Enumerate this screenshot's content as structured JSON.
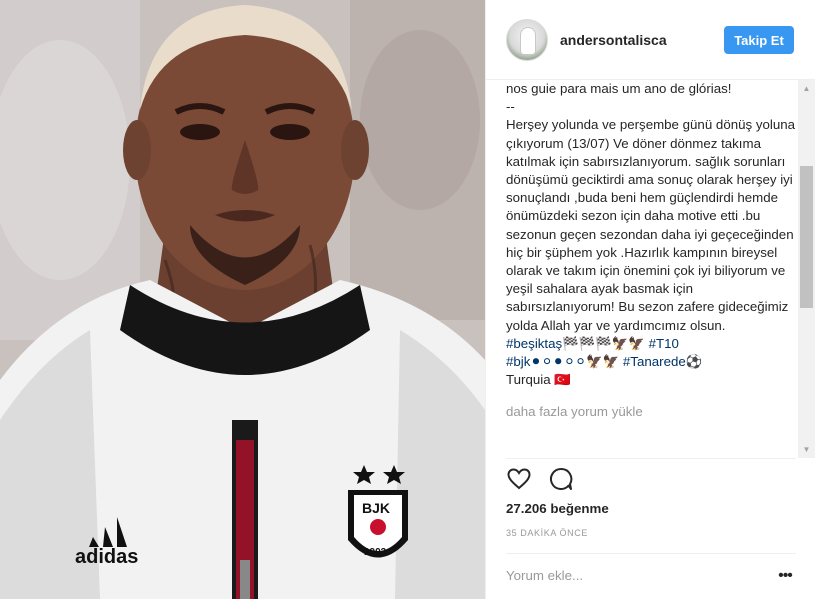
{
  "post": {
    "username": "andersontalisca",
    "follow_label": "Takip Et"
  },
  "caption": {
    "text": "nos guie para mais um ano de glórias!\n--\nHerşey yolunda ve perşembe günü dönüş yoluna çıkıyorum (13/07) Ve döner dönmez takıma katılmak için sabırsızlanıyorum. sağlık sorunları dönüşümü geciktirdi ama sonuç olarak herşey iyi sonuçlandı ,buda beni hem güçlendirdi hemde önümüzdeki sezon için daha motive etti .bu sezonun geçen sezondan daha iyi geçeceğinden hiç bir şüphem yok .Hazırlık kampının bireysel olarak ve takım için önemini çok iyi biliyorum ve yeşil sahalara ayak basmak için sabırsızlanıyorum! Bu sezon zafere gideceğimiz yolda Allah yar ve yardımcımız olsun.",
    "tags_line1": "#beşiktaş🏁🏁🏁🦅🦅 #T10",
    "tags_line2": "#bjk⚫⚪⚫⚪⚪🦅🦅 #Tanarede⚽",
    "location": "Turquia 🇹🇷"
  },
  "load_more_label": "daha fazla yorum yükle",
  "likes_label": "27.206 beğenme",
  "time_label": "35 DAKİKA ÖNCE",
  "comment": {
    "placeholder": "Yorum ekle...",
    "value": ""
  },
  "icons": {
    "like": "heart-icon",
    "comment": "comment-bubble-icon",
    "more": "more-options-icon"
  },
  "colors": {
    "follow_button": "#3897f0",
    "hashtag": "#003569",
    "muted": "#999999"
  }
}
